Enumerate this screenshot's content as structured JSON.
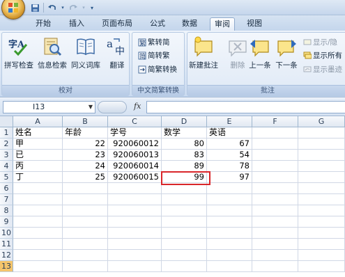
{
  "tabs": [
    "开始",
    "插入",
    "页面布局",
    "公式",
    "数据",
    "审阅",
    "视图"
  ],
  "active_tab": "审阅",
  "ribbon": {
    "proofing": {
      "label": "校对",
      "spell_check": "拼写检查",
      "research": "信息检索",
      "thesaurus": "同义词库",
      "translate": "翻译",
      "spell_icon_text": "字A"
    },
    "chinese_conv": {
      "label": "中文简繁转换",
      "to_simplified": "繁转简",
      "to_traditional": "简转繁",
      "convert": "简繁转换"
    },
    "comments": {
      "label": "批注",
      "new_comment": "新建批注",
      "delete": "删除",
      "previous": "上一条",
      "next": "下一条",
      "show_hide": "显示/隐",
      "show_all": "显示所有",
      "show_ink": "显示墨迹"
    }
  },
  "formula_bar": {
    "name_box": "I13",
    "fx": "fx",
    "content": ""
  },
  "columns": [
    "A",
    "B",
    "C",
    "D",
    "E",
    "F",
    "G"
  ],
  "rows": [
    "1",
    "2",
    "3",
    "4",
    "5",
    "6",
    "7",
    "8",
    "9",
    "10",
    "11",
    "12",
    "13"
  ],
  "table": [
    [
      "姓名",
      "年龄",
      "学号",
      "数学",
      "英语"
    ],
    [
      "甲",
      "22",
      "920060012",
      "80",
      "67"
    ],
    [
      "已",
      "23",
      "920060013",
      "83",
      "54"
    ],
    [
      "丙",
      "24",
      "920060014",
      "89",
      "78"
    ],
    [
      "丁",
      "25",
      "920060015",
      "99",
      "97"
    ]
  ],
  "colors": {
    "highlight": "#d9262a",
    "active_row_header": "#f5c56b"
  }
}
